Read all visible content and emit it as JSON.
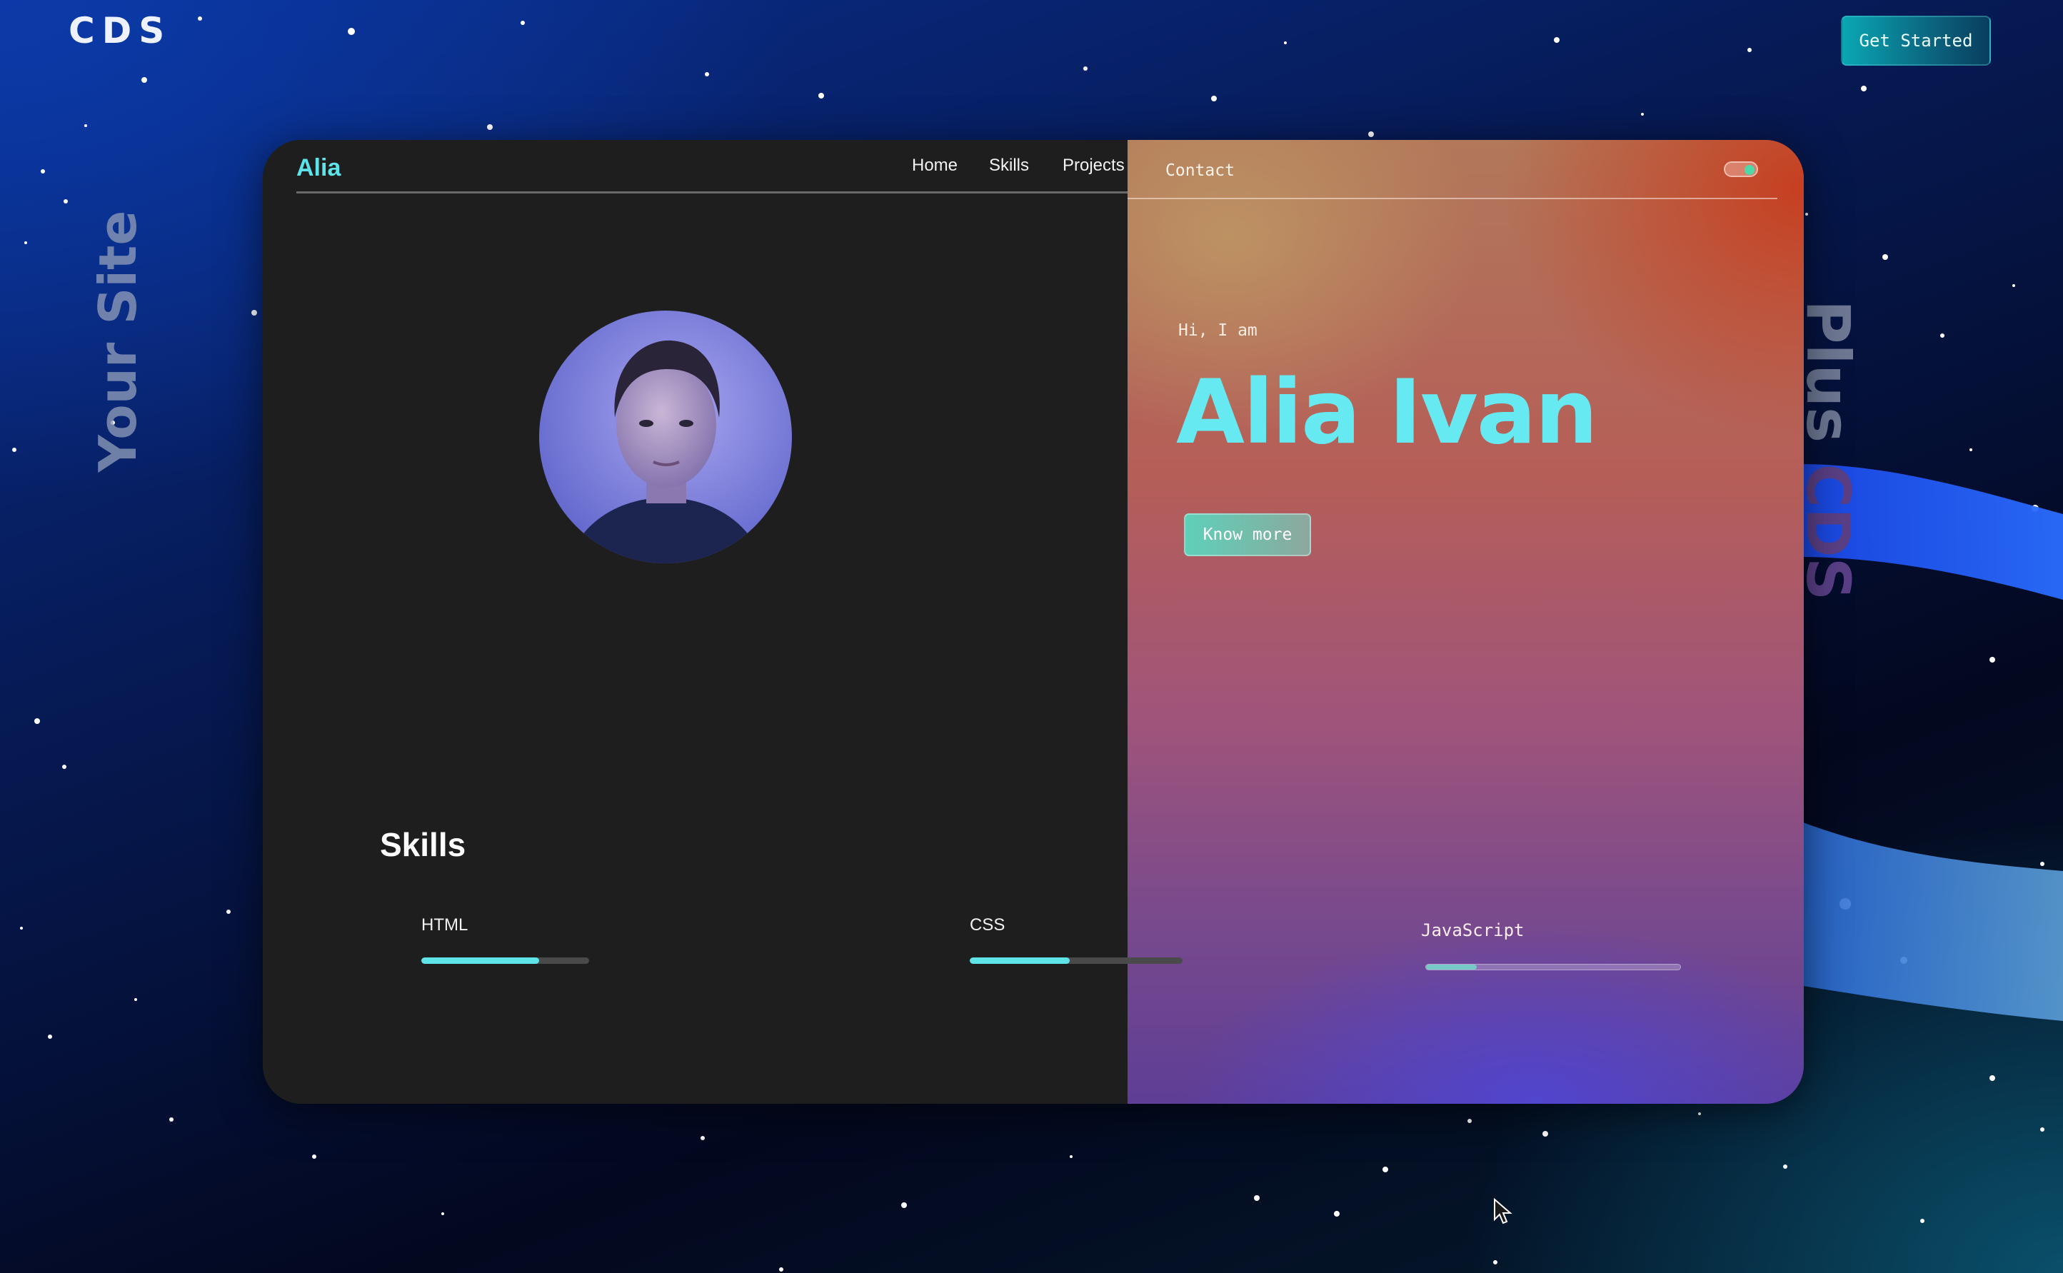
{
  "header": {
    "brand": "CDS",
    "cta_label": "Get Started"
  },
  "side_text": {
    "left": "Your Site",
    "right_part1": "Plus ",
    "right_part2": "CDS"
  },
  "site_preview": {
    "logo": "Alia",
    "nav": {
      "home": "Home",
      "skills": "Skills",
      "projects": "Projects",
      "contact": "Contact"
    },
    "hero": {
      "greeting": "Hi, I am",
      "name": "Alia Ivan",
      "button": "Know more"
    },
    "skills": {
      "title": "Skills",
      "items": [
        {
          "label": "HTML",
          "level": 0.7
        },
        {
          "label": "CSS",
          "level": 0.47
        },
        {
          "label": "JavaScript",
          "level": 0.2
        }
      ]
    }
  },
  "colors": {
    "accent": "#5ee3e8",
    "dark_panel": "#1e1e1e",
    "background": "#061a55"
  }
}
